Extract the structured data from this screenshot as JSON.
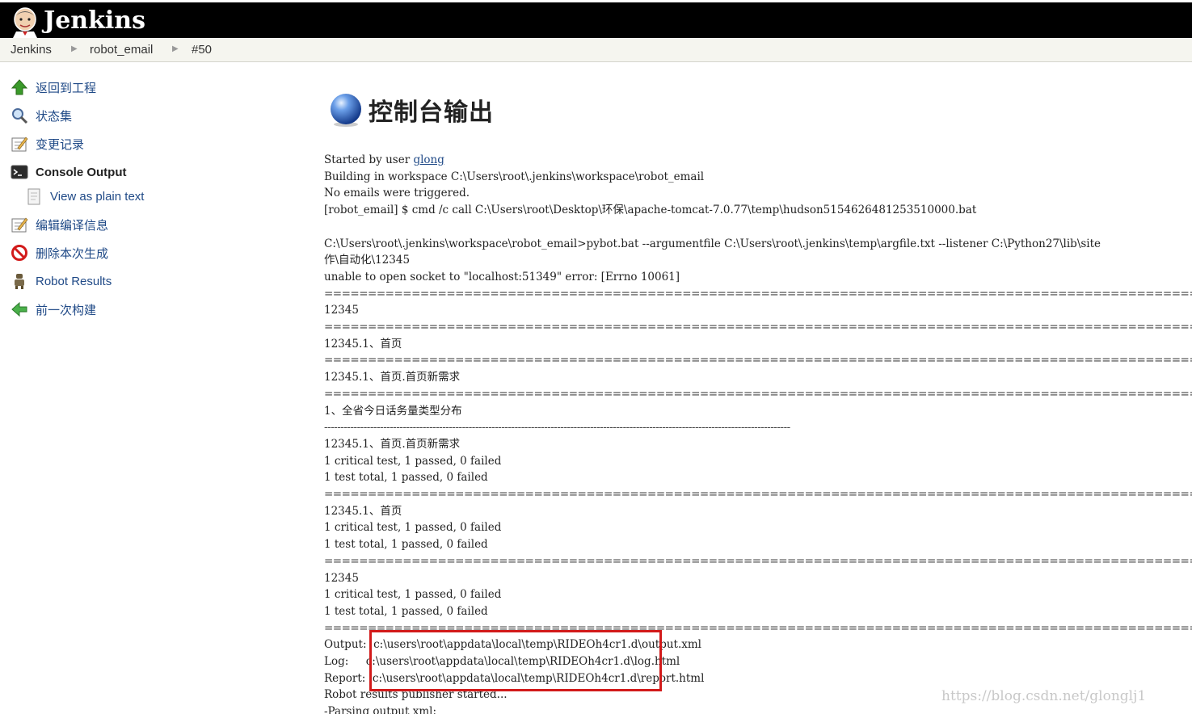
{
  "header": {
    "title": "Jenkins"
  },
  "breadcrumb": [
    "Jenkins",
    "robot_email",
    "#50"
  ],
  "sidebar": {
    "items": [
      {
        "label": "返回到工程",
        "icon": "up-arrow-icon"
      },
      {
        "label": "状态集",
        "icon": "magnifier-icon"
      },
      {
        "label": "变更记录",
        "icon": "notepad-icon"
      },
      {
        "label": "Console Output",
        "icon": "terminal-icon"
      },
      {
        "label": "View as plain text",
        "icon": "document-icon"
      },
      {
        "label": "编辑编译信息",
        "icon": "notepad-edit-icon"
      },
      {
        "label": "删除本次生成",
        "icon": "no-entry-icon"
      },
      {
        "label": "Robot Results",
        "icon": "robot-icon"
      },
      {
        "label": "前一次构建",
        "icon": "left-arrow-icon"
      }
    ]
  },
  "main": {
    "title": "控制台输出",
    "title_icon": "blue-ball-icon"
  },
  "console": {
    "started_prefix": "Started by user ",
    "user": "glong",
    "lines": [
      "Building in workspace C:\\Users\\root\\.jenkins\\workspace\\robot_email",
      "No emails were triggered.",
      "[robot_email] $ cmd /c call C:\\Users\\root\\Desktop\\环保\\apache-tomcat-7.0.77\\temp\\hudson5154626481253510000.bat",
      "",
      "C:\\Users\\root\\.jenkins\\workspace\\robot_email>pybot.bat --argumentfile C:\\Users\\root\\.jenkins\\temp\\argfile.txt --listener C:\\Python27\\lib\\site",
      "作\\自动化\\12345",
      "unable to open socket to \"localhost:51349\" error: [Errno 10061]",
      "==============================================================================================================================================",
      "12345",
      "==============================================================================================================================================",
      "12345.1、首页",
      "==============================================================================================================================================",
      "12345.1、首页.首页新需求",
      "==============================================================================================================================================",
      "1、全省今日话务量类型分布",
      "----------------------------------------------------------------------------------------------------------------------------------------------",
      "12345.1、首页.首页新需求",
      "1 critical test, 1 passed, 0 failed",
      "1 test total, 1 passed, 0 failed",
      "==============================================================================================================================================",
      "12345.1、首页",
      "1 critical test, 1 passed, 0 failed",
      "1 test total, 1 passed, 0 failed",
      "==============================================================================================================================================",
      "12345",
      "1 critical test, 1 passed, 0 failed",
      "1 test total, 1 passed, 0 failed",
      "==============================================================================================================================================",
      "Output:  c:\\users\\root\\appdata\\local\\temp\\RIDEOh4cr1.d\\output.xml",
      "Log:     c:\\users\\root\\appdata\\local\\temp\\RIDEOh4cr1.d\\log.html",
      "Report:  c:\\users\\root\\appdata\\local\\temp\\RIDEOh4cr1.d\\report.html",
      "Robot results publisher started...",
      "-Parsing output xml:"
    ]
  },
  "watermark": "https://blog.csdn.net/glonglj1",
  "colors": {
    "header_bg": "#000000",
    "link": "#204a87",
    "highlight": "#d21a1a"
  }
}
